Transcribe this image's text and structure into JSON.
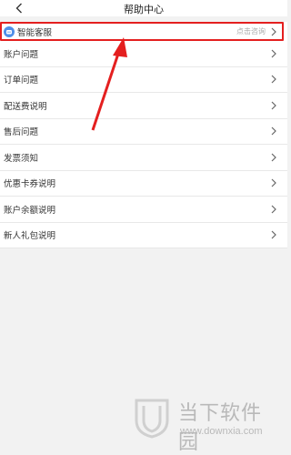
{
  "header": {
    "title": "帮助中心"
  },
  "service": {
    "label": "智能客服",
    "action": "点击咨询"
  },
  "items": [
    {
      "label": "账户问题"
    },
    {
      "label": "订单问题"
    },
    {
      "label": "配送费说明"
    },
    {
      "label": "售后问题"
    },
    {
      "label": "发票须知"
    },
    {
      "label": "优惠卡券说明"
    },
    {
      "label": "账户余额说明"
    },
    {
      "label": "新人礼包说明"
    }
  ],
  "watermark": {
    "title": "当下软件园",
    "url": "www.downxia.com"
  },
  "colors": {
    "highlight": "#e41f1f",
    "service_icon": "#4f8fe8"
  }
}
